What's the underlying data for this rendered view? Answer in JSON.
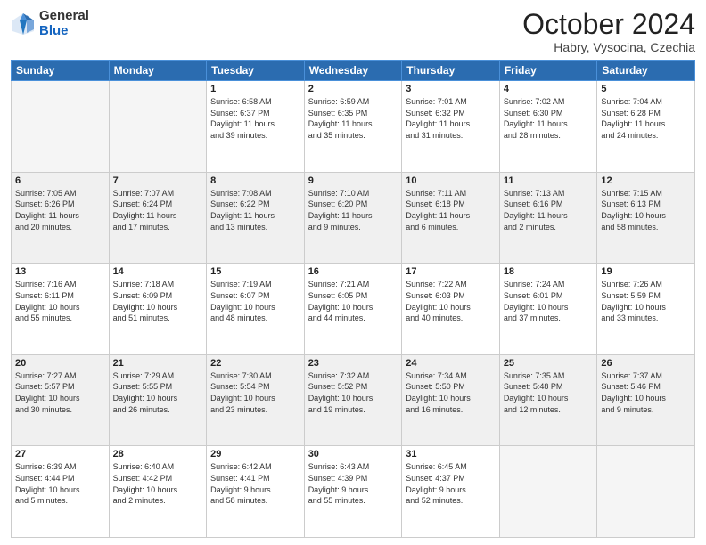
{
  "logo": {
    "general": "General",
    "blue": "Blue"
  },
  "header": {
    "month": "October 2024",
    "location": "Habry, Vysocina, Czechia"
  },
  "weekdays": [
    "Sunday",
    "Monday",
    "Tuesday",
    "Wednesday",
    "Thursday",
    "Friday",
    "Saturday"
  ],
  "weeks": [
    [
      {
        "num": "",
        "info": ""
      },
      {
        "num": "",
        "info": ""
      },
      {
        "num": "1",
        "info": "Sunrise: 6:58 AM\nSunset: 6:37 PM\nDaylight: 11 hours\nand 39 minutes."
      },
      {
        "num": "2",
        "info": "Sunrise: 6:59 AM\nSunset: 6:35 PM\nDaylight: 11 hours\nand 35 minutes."
      },
      {
        "num": "3",
        "info": "Sunrise: 7:01 AM\nSunset: 6:32 PM\nDaylight: 11 hours\nand 31 minutes."
      },
      {
        "num": "4",
        "info": "Sunrise: 7:02 AM\nSunset: 6:30 PM\nDaylight: 11 hours\nand 28 minutes."
      },
      {
        "num": "5",
        "info": "Sunrise: 7:04 AM\nSunset: 6:28 PM\nDaylight: 11 hours\nand 24 minutes."
      }
    ],
    [
      {
        "num": "6",
        "info": "Sunrise: 7:05 AM\nSunset: 6:26 PM\nDaylight: 11 hours\nand 20 minutes."
      },
      {
        "num": "7",
        "info": "Sunrise: 7:07 AM\nSunset: 6:24 PM\nDaylight: 11 hours\nand 17 minutes."
      },
      {
        "num": "8",
        "info": "Sunrise: 7:08 AM\nSunset: 6:22 PM\nDaylight: 11 hours\nand 13 minutes."
      },
      {
        "num": "9",
        "info": "Sunrise: 7:10 AM\nSunset: 6:20 PM\nDaylight: 11 hours\nand 9 minutes."
      },
      {
        "num": "10",
        "info": "Sunrise: 7:11 AM\nSunset: 6:18 PM\nDaylight: 11 hours\nand 6 minutes."
      },
      {
        "num": "11",
        "info": "Sunrise: 7:13 AM\nSunset: 6:16 PM\nDaylight: 11 hours\nand 2 minutes."
      },
      {
        "num": "12",
        "info": "Sunrise: 7:15 AM\nSunset: 6:13 PM\nDaylight: 10 hours\nand 58 minutes."
      }
    ],
    [
      {
        "num": "13",
        "info": "Sunrise: 7:16 AM\nSunset: 6:11 PM\nDaylight: 10 hours\nand 55 minutes."
      },
      {
        "num": "14",
        "info": "Sunrise: 7:18 AM\nSunset: 6:09 PM\nDaylight: 10 hours\nand 51 minutes."
      },
      {
        "num": "15",
        "info": "Sunrise: 7:19 AM\nSunset: 6:07 PM\nDaylight: 10 hours\nand 48 minutes."
      },
      {
        "num": "16",
        "info": "Sunrise: 7:21 AM\nSunset: 6:05 PM\nDaylight: 10 hours\nand 44 minutes."
      },
      {
        "num": "17",
        "info": "Sunrise: 7:22 AM\nSunset: 6:03 PM\nDaylight: 10 hours\nand 40 minutes."
      },
      {
        "num": "18",
        "info": "Sunrise: 7:24 AM\nSunset: 6:01 PM\nDaylight: 10 hours\nand 37 minutes."
      },
      {
        "num": "19",
        "info": "Sunrise: 7:26 AM\nSunset: 5:59 PM\nDaylight: 10 hours\nand 33 minutes."
      }
    ],
    [
      {
        "num": "20",
        "info": "Sunrise: 7:27 AM\nSunset: 5:57 PM\nDaylight: 10 hours\nand 30 minutes."
      },
      {
        "num": "21",
        "info": "Sunrise: 7:29 AM\nSunset: 5:55 PM\nDaylight: 10 hours\nand 26 minutes."
      },
      {
        "num": "22",
        "info": "Sunrise: 7:30 AM\nSunset: 5:54 PM\nDaylight: 10 hours\nand 23 minutes."
      },
      {
        "num": "23",
        "info": "Sunrise: 7:32 AM\nSunset: 5:52 PM\nDaylight: 10 hours\nand 19 minutes."
      },
      {
        "num": "24",
        "info": "Sunrise: 7:34 AM\nSunset: 5:50 PM\nDaylight: 10 hours\nand 16 minutes."
      },
      {
        "num": "25",
        "info": "Sunrise: 7:35 AM\nSunset: 5:48 PM\nDaylight: 10 hours\nand 12 minutes."
      },
      {
        "num": "26",
        "info": "Sunrise: 7:37 AM\nSunset: 5:46 PM\nDaylight: 10 hours\nand 9 minutes."
      }
    ],
    [
      {
        "num": "27",
        "info": "Sunrise: 6:39 AM\nSunset: 4:44 PM\nDaylight: 10 hours\nand 5 minutes."
      },
      {
        "num": "28",
        "info": "Sunrise: 6:40 AM\nSunset: 4:42 PM\nDaylight: 10 hours\nand 2 minutes."
      },
      {
        "num": "29",
        "info": "Sunrise: 6:42 AM\nSunset: 4:41 PM\nDaylight: 9 hours\nand 58 minutes."
      },
      {
        "num": "30",
        "info": "Sunrise: 6:43 AM\nSunset: 4:39 PM\nDaylight: 9 hours\nand 55 minutes."
      },
      {
        "num": "31",
        "info": "Sunrise: 6:45 AM\nSunset: 4:37 PM\nDaylight: 9 hours\nand 52 minutes."
      },
      {
        "num": "",
        "info": ""
      },
      {
        "num": "",
        "info": ""
      }
    ]
  ]
}
